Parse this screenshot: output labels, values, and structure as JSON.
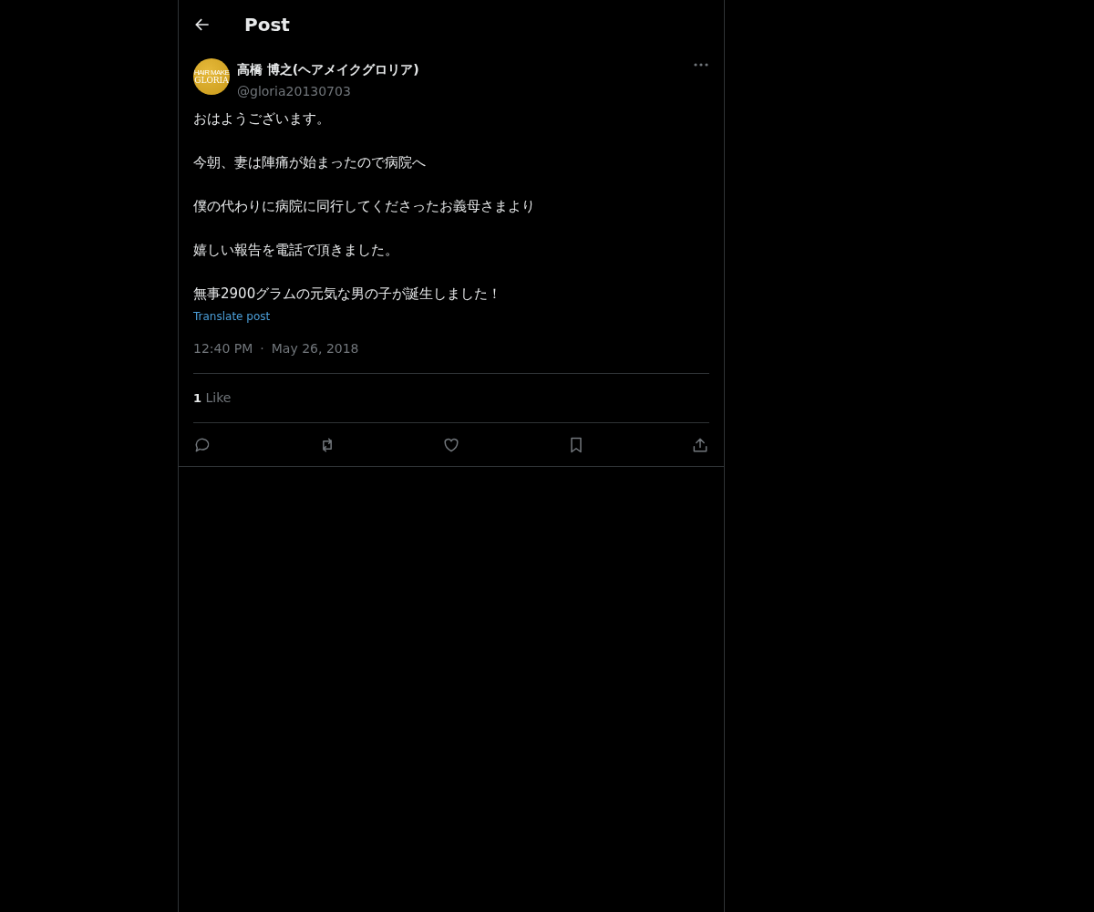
{
  "header": {
    "title": "Post"
  },
  "author": {
    "logo_top": "HAIR MAKE",
    "logo_main": "GLORIA",
    "name": "高橋 博之(ヘアメイクグロリア)",
    "handle": "@gloria20130703"
  },
  "paragraphs": [
    "おはようございます。",
    "今朝、妻は陣痛が始まったので病院へ",
    "僕の代わりに病院に同行してくださったお義母さまより",
    "嬉しい報告を電話で頂きました。",
    "無事2900グラムの元気な男の子が誕生しました！"
  ],
  "translate": "Translate post",
  "time": "12:40 PM",
  "separator": "·",
  "date": "May 26, 2018",
  "likes": {
    "count": "1",
    "label": "Like"
  },
  "actions": [
    {
      "kind": "reply"
    },
    {
      "kind": "repost"
    },
    {
      "kind": "like"
    },
    {
      "kind": "bookmark"
    },
    {
      "kind": "share"
    }
  ]
}
